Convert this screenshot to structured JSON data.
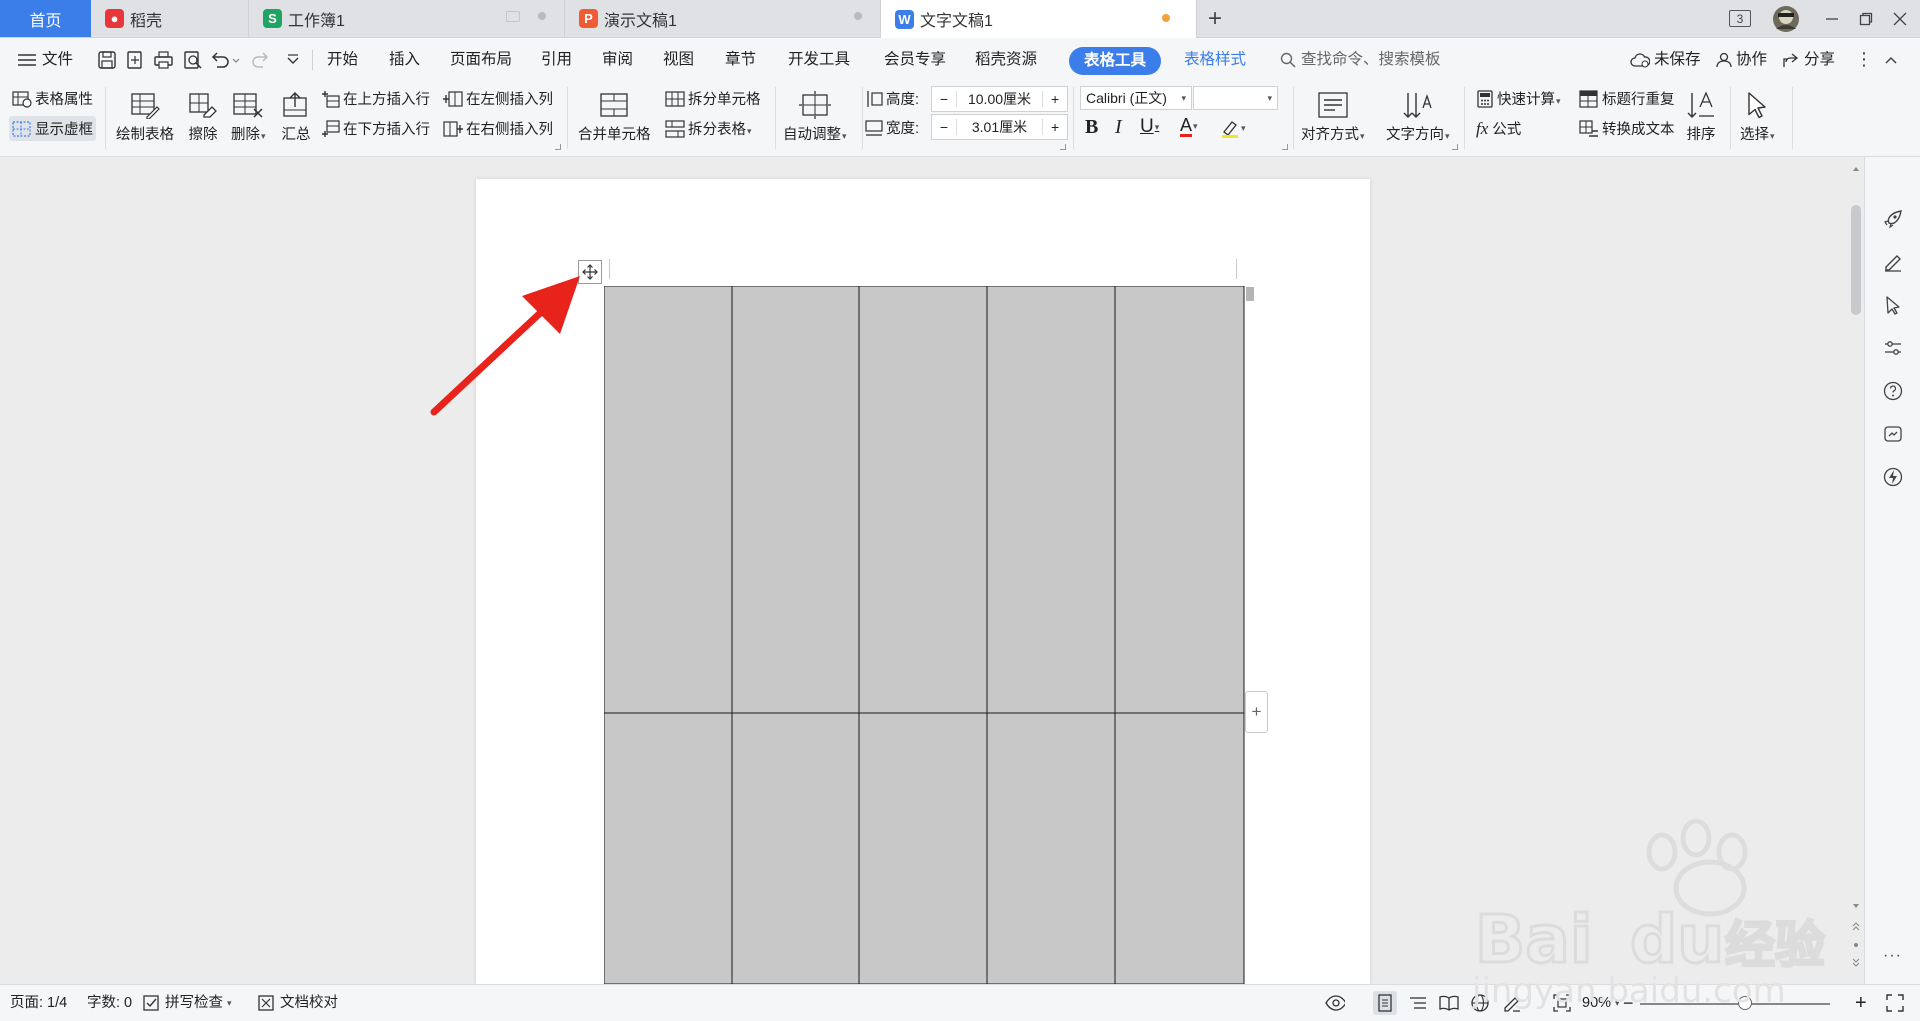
{
  "tabs": {
    "home": "首页",
    "daoke": "稻壳",
    "workbook": "工作簿1",
    "presentation": "演示文稿1",
    "document": "文字文稿1",
    "add": "+",
    "window_count": "3"
  },
  "menu": {
    "file": "文件",
    "items": [
      "开始",
      "插入",
      "页面布局",
      "引用",
      "审阅",
      "视图",
      "章节",
      "开发工具",
      "会员专享",
      "稻壳资源"
    ],
    "table_tools": "表格工具",
    "table_style": "表格样式",
    "search": "查找命令、搜索模板",
    "unsaved": "未保存",
    "collab": "协作",
    "share": "分享"
  },
  "ribbon": {
    "table_props": "表格属性",
    "show_gridlines": "显示虚框",
    "draw_table": "绘制表格",
    "erase": "擦除",
    "delete": "删除",
    "summary": "汇总",
    "insert_row_above": "在上方插入行",
    "insert_row_below": "在下方插入行",
    "insert_col_left": "在左侧插入列",
    "insert_col_right": "在右侧插入列",
    "merge_cells": "合并单元格",
    "split_cells": "拆分单元格",
    "split_table": "拆分表格",
    "auto_fit": "自动调整",
    "height_label": "高度:",
    "height_value": "10.00厘米",
    "width_label": "宽度:",
    "width_value": "3.01厘米",
    "minus": "−",
    "plus": "+",
    "font_name": "Calibri (正文)",
    "font_size": "",
    "align": "对齐方式",
    "text_dir": "文字方向",
    "quick_calc": "快速计算",
    "formula": "公式",
    "repeat_header": "标题行重复",
    "to_text": "转换成文本",
    "sort": "排序",
    "select": "选择"
  },
  "status": {
    "page": "页面: 1/4",
    "words": "字数: 0",
    "spellcheck": "拼写检查",
    "proof": "文档校对",
    "zoom": "90%",
    "zoom_minus": "−",
    "zoom_plus": "+",
    "zoom_level": 0.55
  },
  "colors": {
    "accent": "#3b7de9",
    "cell_fill": "#c8c8c8",
    "arrow": "#e8231b"
  }
}
